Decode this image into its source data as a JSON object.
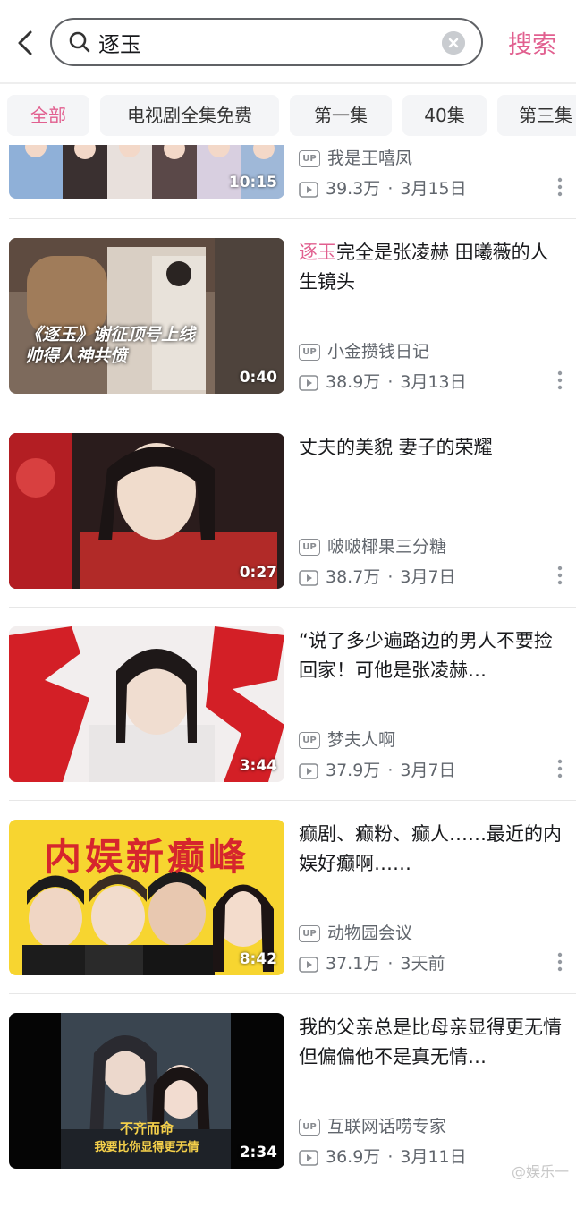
{
  "search": {
    "query": "逐玉",
    "button_label": "搜索"
  },
  "tabs": [
    {
      "label": "全部",
      "active": true
    },
    {
      "label": "电视剧全集免费",
      "active": false
    },
    {
      "label": "第一集",
      "active": false
    },
    {
      "label": "40集",
      "active": false
    },
    {
      "label": "第三集",
      "active": false
    }
  ],
  "results": [
    {
      "title_plain": "",
      "uploader": "我是王嘻凤",
      "views": "39.3万",
      "date": "3月15日",
      "duration": "10:15"
    },
    {
      "title_highlight": "逐玉",
      "title_rest": "完全是张凌赫 田曦薇的人生镜头",
      "uploader": "小金攒钱日记",
      "views": "38.9万",
      "date": "3月13日",
      "duration": "0:40",
      "thumb_caption_line1": "《逐玉》谢征顶号上线",
      "thumb_caption_line2": "帅得人神共愤"
    },
    {
      "title_plain": "丈夫的美貌 妻子的荣耀",
      "uploader": "啵啵椰果三分糖",
      "views": "38.7万",
      "date": "3月7日",
      "duration": "0:27"
    },
    {
      "title_plain": "“说了多少遍路边的男人不要捡回家！可他是张凌赫…",
      "uploader": "梦夫人啊",
      "views": "37.9万",
      "date": "3月7日",
      "duration": "3:44"
    },
    {
      "title_plain": "癫剧、癫粉、癫人……最近的内娱好癫啊……",
      "uploader": "动物园会议",
      "views": "37.1万",
      "date": "3天前",
      "duration": "8:42",
      "thumb_banner": "内娱新癫峰"
    },
    {
      "title_plain": "我的父亲总是比母亲显得更无情但偏偏他不是真无情…",
      "uploader": "互联网话唠专家",
      "views": "36.9万",
      "date": "3月11日",
      "duration": "2:34",
      "thumb_sub_line1": "不齐而命",
      "thumb_sub_line2": "我要比你显得更无情"
    }
  ],
  "icons": {
    "back": "chevron-left-icon",
    "search": "search-icon",
    "clear": "clear-icon",
    "uploader": "up-badge-icon",
    "views": "play-count-icon",
    "more": "more-vertical-icon"
  },
  "colors": {
    "accent": "#e15f8f",
    "text": "#18191c",
    "meta": "#61666d"
  },
  "watermark": "@娱乐一"
}
